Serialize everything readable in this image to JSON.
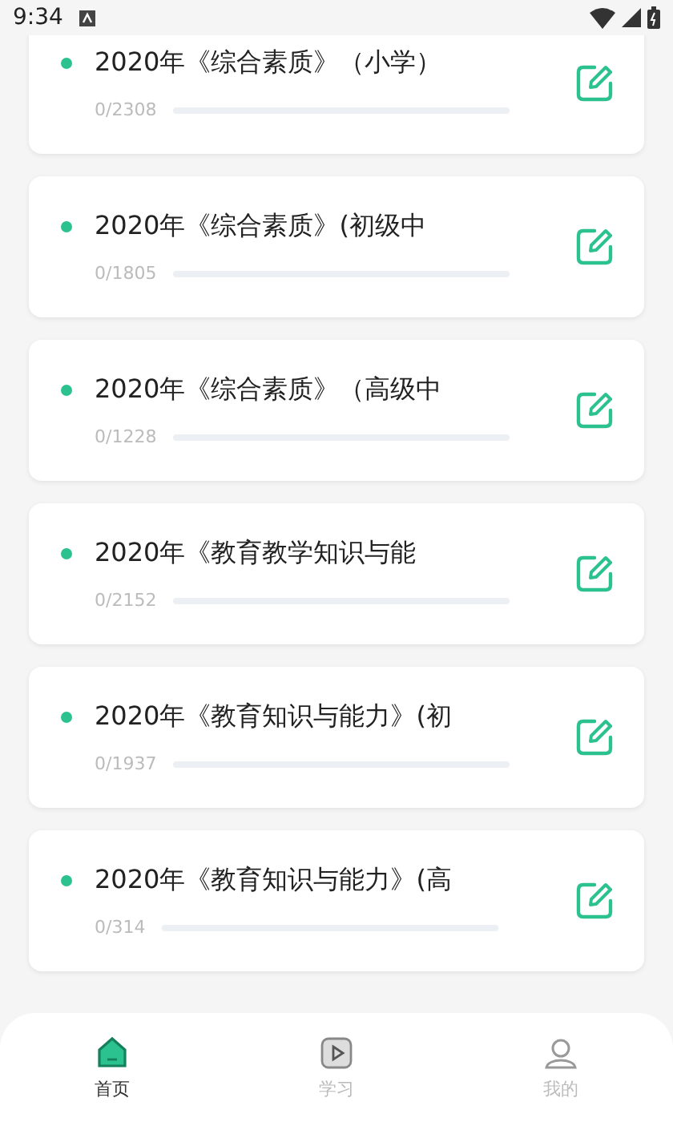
{
  "status_bar": {
    "time": "9:34"
  },
  "courses": [
    {
      "title": "2020年《综合素质》（小学）",
      "progress": "0/2308",
      "level": 0
    },
    {
      "title": "2020年《综合素质》(初级中",
      "progress": "0/1805",
      "level": 0
    },
    {
      "title": "2020年《综合素质》（高级中",
      "progress": "0/1228",
      "level": 0
    },
    {
      "title": "2020年《教育教学知识与能",
      "progress": "0/2152",
      "level": 0
    },
    {
      "title": "2020年《教育知识与能力》(初",
      "progress": "0/1937",
      "level": 0
    },
    {
      "title": "2020年《教育知识与能力》(高",
      "progress": "0/314",
      "level": 0
    }
  ],
  "nav": [
    {
      "kind": "home",
      "label": "首页",
      "selected": true
    },
    {
      "kind": "study",
      "label": "学习",
      "selected": false
    },
    {
      "kind": "profile",
      "label": "我的",
      "selected": false
    }
  ]
}
